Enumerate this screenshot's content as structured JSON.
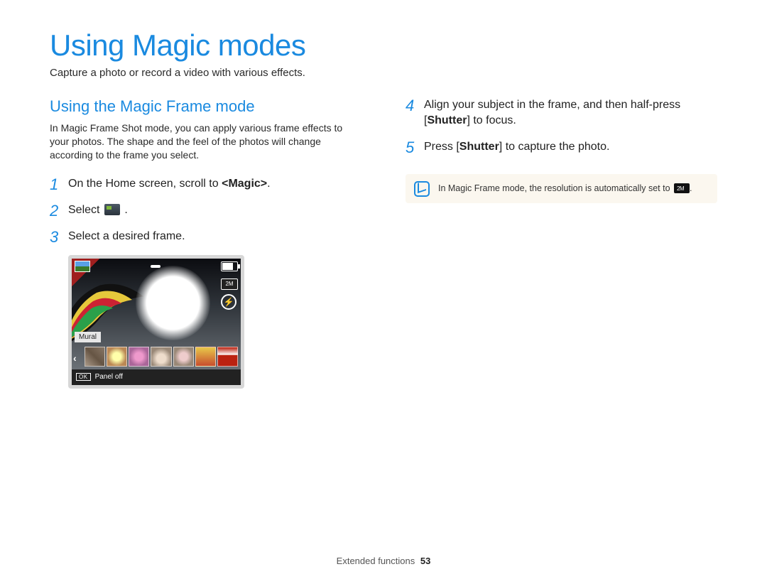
{
  "page": {
    "title": "Using Magic modes",
    "subtitle": "Capture a photo or record a video with various effects."
  },
  "section": {
    "title": "Using the Magic Frame mode",
    "description": "In Magic Frame Shot mode, you can apply various frame effects to your photos. The shape and the feel of the photos will change according to the frame you select."
  },
  "steps_left": [
    {
      "n": "1",
      "pre": "On the Home screen, scroll to ",
      "bold": "<Magic>",
      "post": "."
    },
    {
      "n": "2",
      "pre": "Select ",
      "icon": true,
      "post": "."
    },
    {
      "n": "3",
      "pre": "Select a desired frame.",
      "bold": "",
      "post": ""
    }
  ],
  "steps_right": [
    {
      "n": "4",
      "pre": "Align your subject in the frame, and then half-press [",
      "bold": "Shutter",
      "post": "] to focus."
    },
    {
      "n": "5",
      "pre": "Press [",
      "bold": "Shutter",
      "post": "] to capture the photo."
    }
  ],
  "camera": {
    "frame_label": "Mural",
    "ok_label": "OK",
    "panel_off": "Panel off",
    "res_badge": "2M"
  },
  "note": {
    "text_pre": "In Magic Frame mode, the resolution is automatically set to ",
    "text_post": "."
  },
  "footer": {
    "section": "Extended functions",
    "page": "53"
  }
}
